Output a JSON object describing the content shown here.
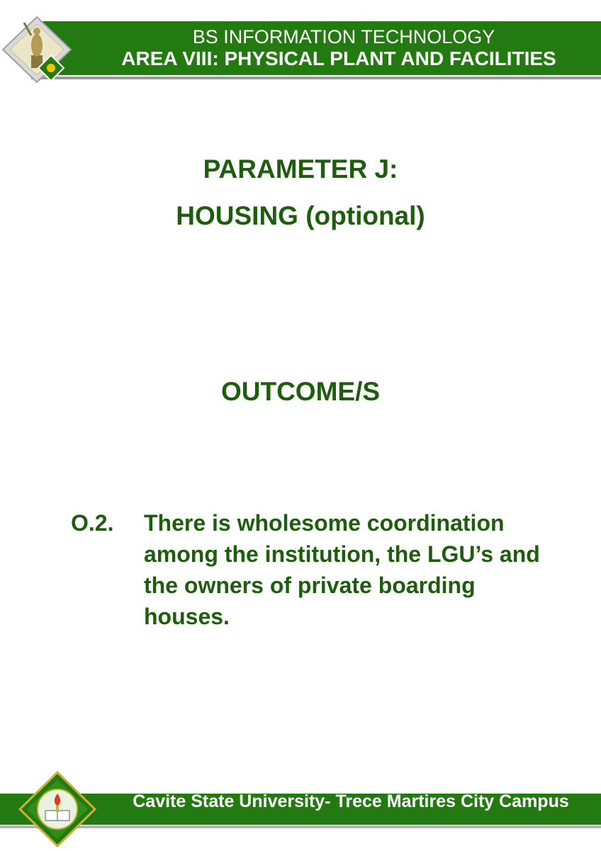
{
  "header": {
    "line1": "BS INFORMATION TECHNOLOGY",
    "line2": "AREA VIII: PHYSICAL PLANT AND FACILITIES",
    "logo_icon": "statue-logo-icon"
  },
  "main": {
    "parameter_title": "PARAMETER J:",
    "parameter_subtitle": "HOUSING (optional)",
    "outcome_heading": "OUTCOME/S",
    "outcome": {
      "number": "O.2.",
      "text": "There is wholesome coordination among the institution, the LGU’s and the owners of private boarding houses."
    }
  },
  "footer": {
    "text": "Cavite State University- Trece Martires City Campus",
    "seal_icon": "university-seal-icon"
  },
  "colors": {
    "brand_green": "#237a10",
    "title_green": "#1e5c0e",
    "rule_gray": "#9a9a9a"
  }
}
